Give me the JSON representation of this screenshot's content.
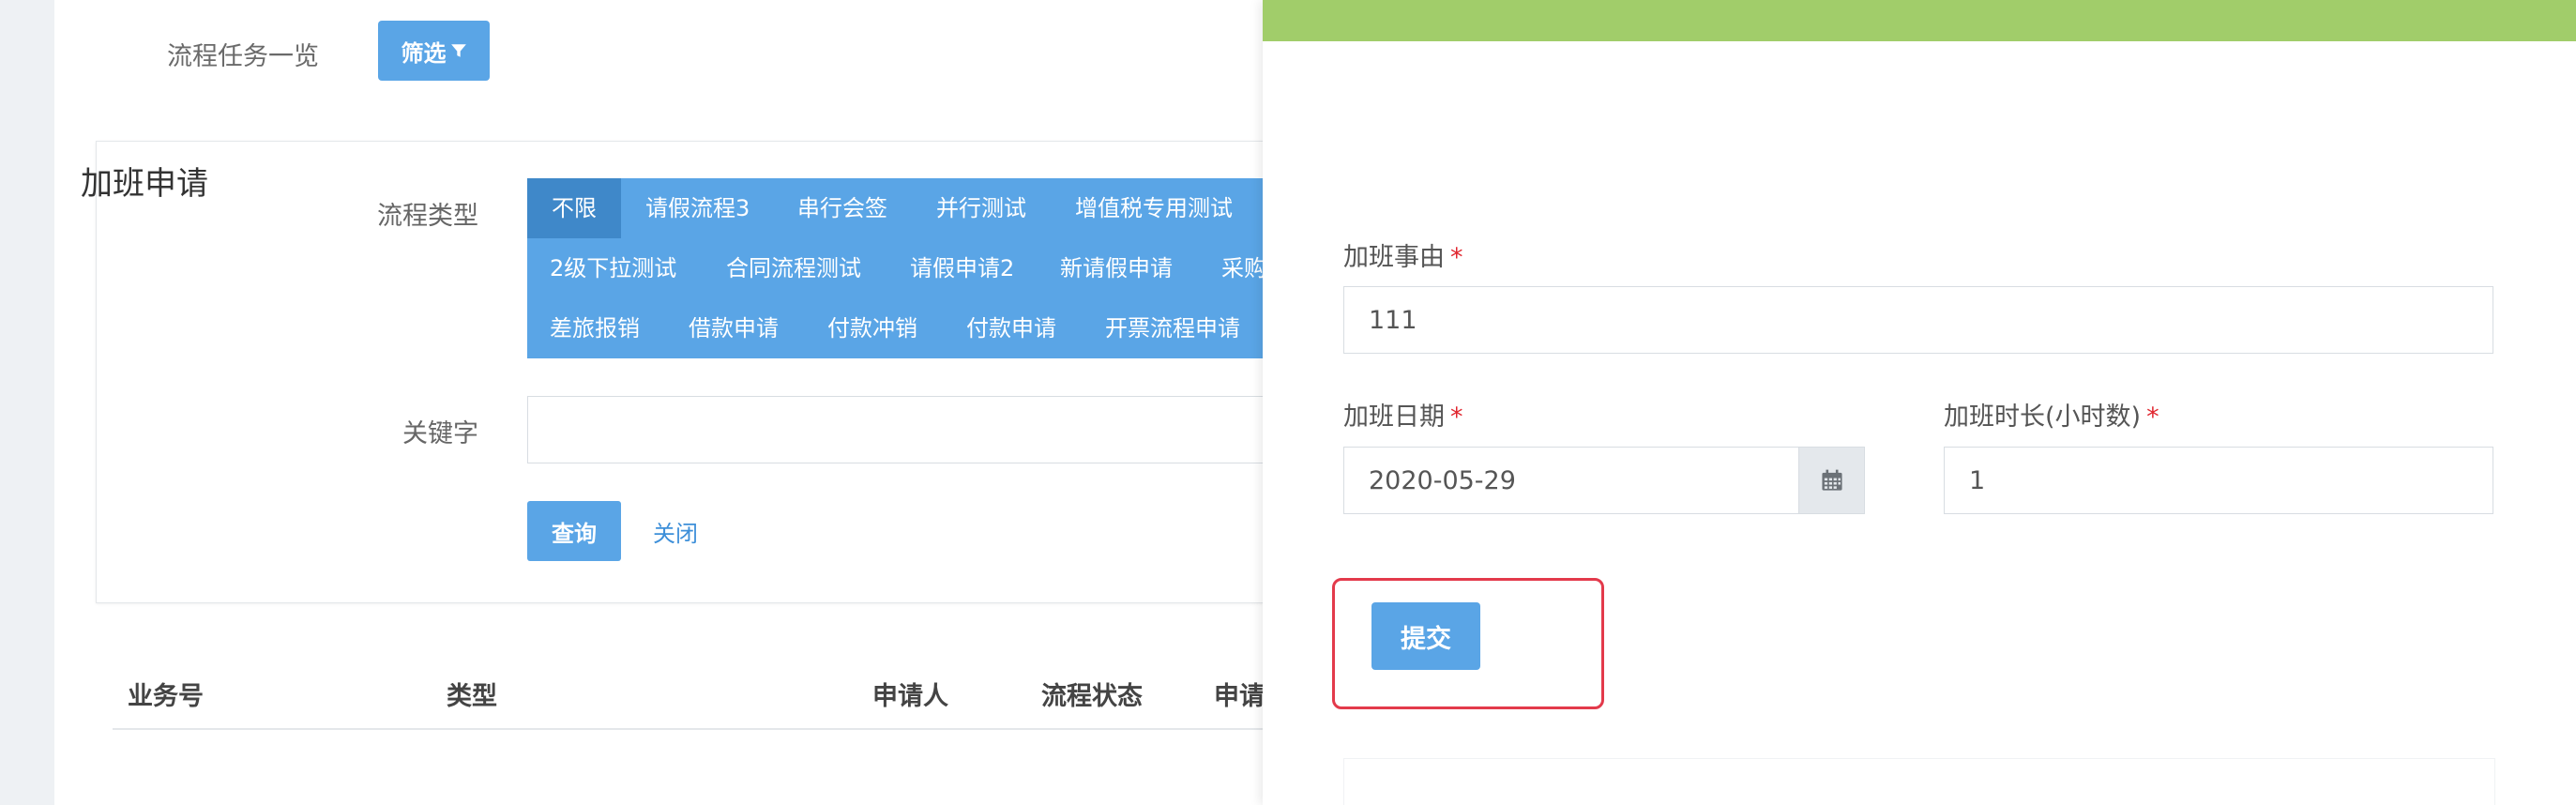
{
  "page": {
    "title": "流程任务一览",
    "filter_button": "筛选",
    "filter": {
      "type_label": "流程类型",
      "types": [
        [
          "不限",
          "请假流程3",
          "串行会签",
          "并行测试",
          "增值税专用测试"
        ],
        [
          "2级下拉测试",
          "合同流程测试",
          "请假申请2",
          "新请假申请",
          "采购"
        ],
        [
          "差旅报销",
          "借款申请",
          "付款冲销",
          "付款申请",
          "开票流程申请"
        ]
      ],
      "keyword_label": "关键字",
      "query_button": "查询",
      "close_link": "关闭"
    },
    "table": {
      "headers": [
        "业务号",
        "类型",
        "申请人",
        "流程状态",
        "申请"
      ]
    }
  },
  "drawer": {
    "form_title": "加班申请",
    "reason_label": "加班事由",
    "reason_value": "111",
    "date_label": "加班日期",
    "date_value": "2020-05-29",
    "hours_label": "加班时长(小时数)",
    "hours_value": "1",
    "required_mark": "*",
    "submit_button": "提交"
  },
  "colors": {
    "primary": "#5aa5e6",
    "active": "#3f88c9",
    "topbar": "#a1cd6a",
    "highlight": "#e33a4b",
    "required": "#e0262f"
  }
}
